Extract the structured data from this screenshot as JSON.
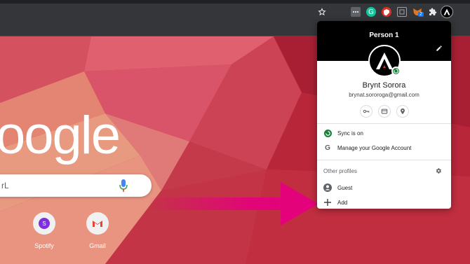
{
  "brand_colors": {
    "menu_header": "#000000",
    "sync_green": "#188038",
    "arrow": "#e5007d",
    "wallpaper": "#c23a48"
  },
  "toolbar": {
    "icons": [
      "star-icon",
      "extension-dots-icon",
      "grammarly-icon",
      "extension-red-icon",
      "extension-gray-icon",
      "metamask-icon",
      "puzzle-icon",
      "profile-avatar-icon"
    ],
    "metamask_badge": "2"
  },
  "ntp": {
    "logo": "oogle",
    "search_placeholder": "rL",
    "shortcuts": [
      {
        "label": "Spotify",
        "icon": "spotify-icon",
        "letter": "S"
      },
      {
        "label": "Gmail",
        "icon": "gmail-icon",
        "letter": "M"
      }
    ]
  },
  "profile_menu": {
    "title": "Person 1",
    "name": "Brynt Sorora",
    "email": "brynat.sororoga@gmail.com",
    "quick_icons": [
      "key-icon",
      "card-icon",
      "location-icon"
    ],
    "sync_label": "Sync is on",
    "manage_label": "Manage your Google Account",
    "other_profiles_label": "Other profiles",
    "guest_label": "Guest",
    "add_label": "Add"
  }
}
